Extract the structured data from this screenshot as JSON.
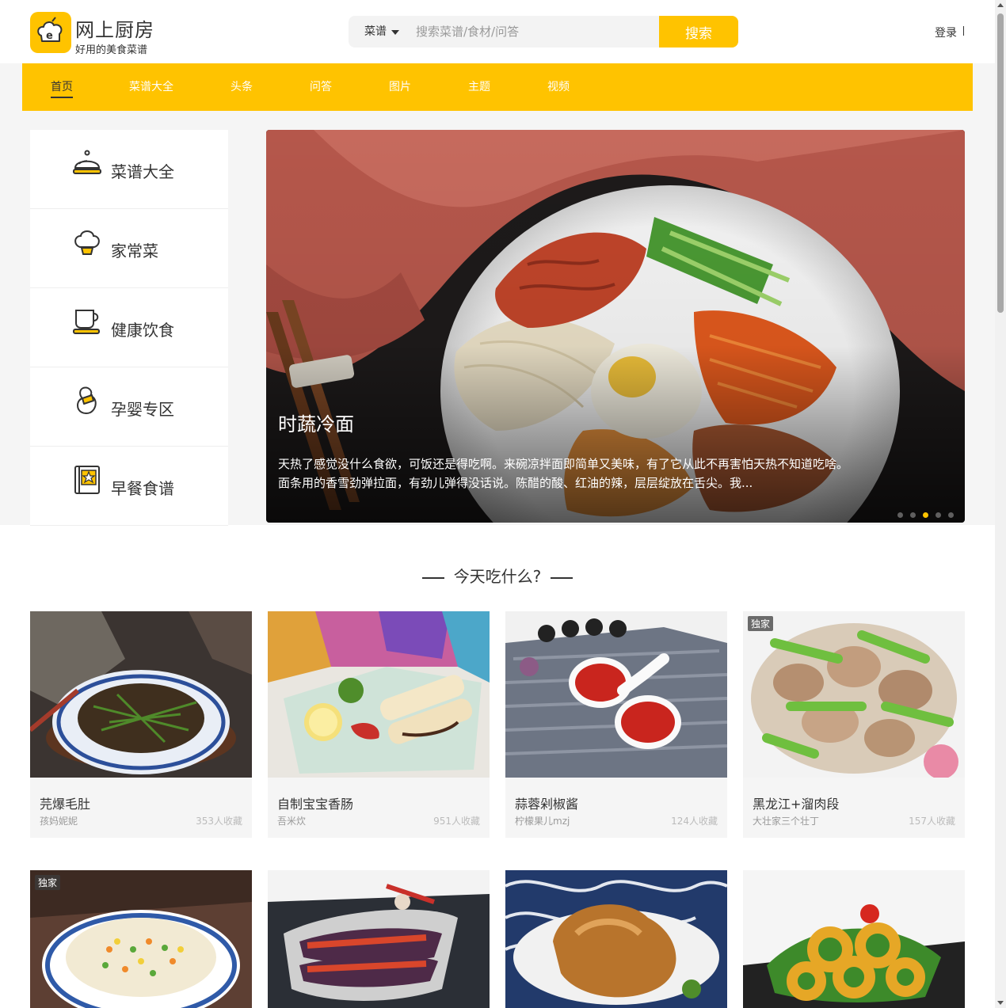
{
  "header": {
    "site_title": "网上厨房",
    "site_subtitle": "好用的美食菜谱",
    "search": {
      "category": "菜谱",
      "placeholder": "搜索菜谱/食材/问答",
      "button": "搜索"
    },
    "login": "登录"
  },
  "nav": {
    "items": [
      "首页",
      "菜谱大全",
      "头条",
      "问答",
      "图片",
      "主题",
      "视频"
    ],
    "active": "首页"
  },
  "side_menu": [
    {
      "label": "菜谱大全",
      "icon": "cloche-icon"
    },
    {
      "label": "家常菜",
      "icon": "chef-hat-icon"
    },
    {
      "label": "健康饮食",
      "icon": "cup-icon"
    },
    {
      "label": "孕婴专区",
      "icon": "baby-bottle-icon"
    },
    {
      "label": "早餐食谱",
      "icon": "star-book-icon"
    }
  ],
  "banner": {
    "title": "时蔬冷面",
    "description": "天热了感觉没什么食欲，可饭还是得吃啊。来碗凉拌面即简单又美味，有了它从此不再害怕天热不知道吃啥。面条用的香雪劲弹拉面，有劲儿弹得没话说。陈醋的酸、红油的辣，层层绽放在舌尖。我...",
    "slide_count": 5,
    "active_slide": 3
  },
  "section": {
    "title": "今天吃什么?"
  },
  "recipes": [
    {
      "name": "芫爆毛肚",
      "author": "孩妈妮妮",
      "favorites": "353人收藏",
      "badge": ""
    },
    {
      "name": "自制宝宝香肠",
      "author": "吾米炊",
      "favorites": "951人收藏",
      "badge": ""
    },
    {
      "name": "蒜蓉剁椒酱",
      "author": "柠檬果儿mzj",
      "favorites": "124人收藏",
      "badge": ""
    },
    {
      "name": "黑龙江+溜肉段",
      "author": "大壮家三个壮丁",
      "favorites": "157人收藏",
      "badge": "独家"
    },
    {
      "name": "",
      "author": "",
      "favorites": "",
      "badge": "独家"
    },
    {
      "name": "",
      "author": "",
      "favorites": "",
      "badge": ""
    },
    {
      "name": "",
      "author": "",
      "favorites": "",
      "badge": ""
    },
    {
      "name": "",
      "author": "",
      "favorites": "",
      "badge": ""
    }
  ],
  "colors": {
    "accent": "#ffc300",
    "text": "#333333",
    "muted": "#999999",
    "band": "#f5f5f5"
  }
}
